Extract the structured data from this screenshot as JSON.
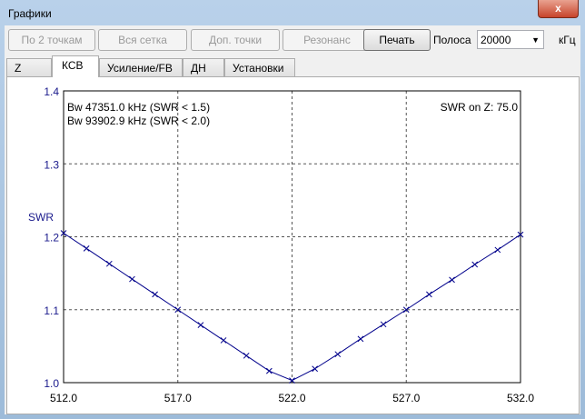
{
  "window": {
    "title": "Графики",
    "close": "x"
  },
  "toolbar": {
    "btn_2pts": "По 2 точкам",
    "btn_grid": "Вся сетка",
    "btn_extra": "Доп. точки",
    "btn_res": "Резонанс",
    "btn_print": "Печать",
    "band_label": "Полоса",
    "band_value": "20000",
    "band_unit": "кГц"
  },
  "tabs": [
    "Z",
    "КСВ",
    "Усиление/FB",
    "ДН",
    "Установки"
  ],
  "chart_data": {
    "type": "line",
    "ylabel": "SWR",
    "xlim": [
      512,
      532
    ],
    "ylim": [
      1.0,
      1.4
    ],
    "xticks": [
      "512.0",
      "517.0",
      "522.0",
      "527.0",
      "532.0"
    ],
    "yticks": [
      "1.0",
      "1.1",
      "1.2",
      "1.3",
      "1.4"
    ],
    "grid": true,
    "annotations": [
      "Bw 47351.0 kHz (SWR < 1.5)",
      "Bw 93902.9 kHz (SWR < 2.0)",
      "SWR on Z: 75.0"
    ],
    "x": [
      512,
      513,
      514,
      515,
      516,
      517,
      518,
      519,
      520,
      521,
      522,
      523,
      524,
      525,
      526,
      527,
      528,
      529,
      530,
      531,
      532
    ],
    "y": [
      1.205,
      1.184,
      1.163,
      1.142,
      1.121,
      1.1,
      1.079,
      1.058,
      1.037,
      1.016,
      1.003,
      1.019,
      1.039,
      1.06,
      1.08,
      1.1,
      1.121,
      1.141,
      1.162,
      1.182,
      1.203
    ],
    "line_color": "#00008b"
  }
}
